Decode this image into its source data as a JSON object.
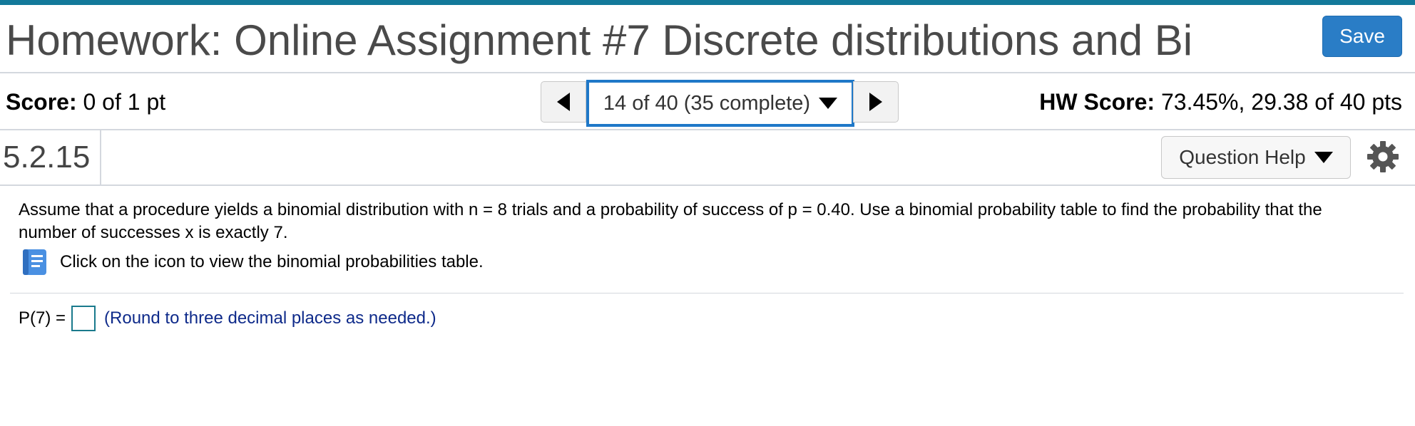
{
  "header": {
    "title": "Homework: Online Assignment #7 Discrete distributions and Bi",
    "save_label": "Save"
  },
  "score_bar": {
    "score_label": "Score:",
    "score_value": "0 of 1 pt",
    "nav": {
      "position_label": "14 of 40 (35 complete)",
      "prev_icon": "triangle-left-icon",
      "next_icon": "triangle-right-icon"
    },
    "hw_score_label": "HW Score:",
    "hw_score_value": "73.45%, 29.38 of 40 pts"
  },
  "question_bar": {
    "question_number": "5.2.15",
    "help_label": "Question Help",
    "settings_icon": "gear-icon"
  },
  "problem": {
    "text": "Assume that a procedure yields a binomial distribution with n = 8 trials and a probability of success of p = 0.40. Use a binomial probability table to find the probability that the number of successes x is exactly 7.",
    "table_link_text": "Click on the icon to view the binomial probabilities table.",
    "table_icon": "book-icon"
  },
  "answer": {
    "label": "P(7) =",
    "value": "",
    "hint": "(Round to three decimal places as needed.)"
  },
  "colors": {
    "top_bar": "#13799a",
    "save_button": "#2a7dc6",
    "nav_highlight": "#1f78c8",
    "hint_text": "#0e2a8a",
    "book_icon": "#4a90e2"
  }
}
